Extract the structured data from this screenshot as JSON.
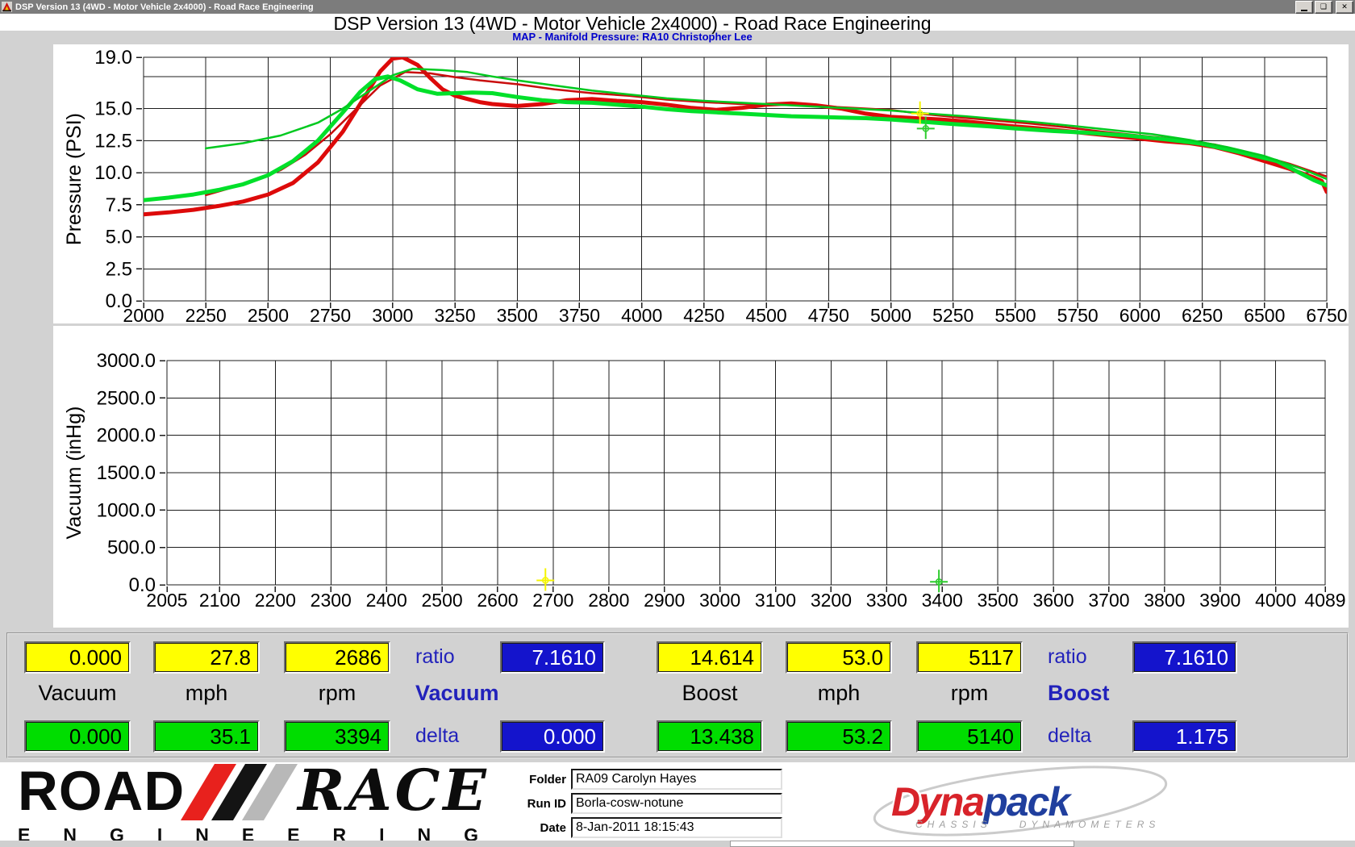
{
  "window": {
    "title": "DSP Version 13 (4WD - Motor Vehicle 2x4000) - Road Race Engineering",
    "icons": {
      "minimize": "_",
      "restore": "❏",
      "close": "✕"
    }
  },
  "header": {
    "title": "DSP Version 13 (4WD - Motor Vehicle 2x4000) - Road Race Engineering",
    "subtitle": "MAP - Manifold Pressure: RA10 Christopher Lee"
  },
  "chart_data": [
    {
      "type": "line",
      "name": "manifold-pressure-vs-rpm",
      "ylabel": "Pressure (PSI)",
      "xlim": [
        2000,
        6750
      ],
      "ylim": [
        0,
        19
      ],
      "xticks": [
        2000,
        2250,
        2500,
        2750,
        3000,
        3250,
        3500,
        3750,
        4000,
        4250,
        4500,
        4750,
        5000,
        5250,
        5500,
        5750,
        6000,
        6250,
        6500,
        6750
      ],
      "yticks_labeled": [
        0,
        2.5,
        5,
        7.5,
        10,
        12.5,
        15,
        19
      ],
      "ygrid": [
        2.5,
        5,
        7.5,
        10,
        12.5,
        15,
        17.5
      ],
      "grid": true,
      "series": [
        {
          "name": "boost-run1-thick-red",
          "color": "#dd0a0a",
          "width": 5,
          "points": [
            [
              2000,
              6.75
            ],
            [
              2100,
              6.9
            ],
            [
              2200,
              7.1
            ],
            [
              2300,
              7.4
            ],
            [
              2400,
              7.75
            ],
            [
              2500,
              8.3
            ],
            [
              2600,
              9.2
            ],
            [
              2700,
              10.8
            ],
            [
              2800,
              13.2
            ],
            [
              2900,
              16.3
            ],
            [
              2950,
              17.9
            ],
            [
              3000,
              18.9
            ],
            [
              3040,
              19.0
            ],
            [
              3100,
              18.4
            ],
            [
              3150,
              17.4
            ],
            [
              3200,
              16.5
            ],
            [
              3250,
              16.0
            ],
            [
              3300,
              15.75
            ],
            [
              3350,
              15.5
            ],
            [
              3400,
              15.35
            ],
            [
              3500,
              15.2
            ],
            [
              3600,
              15.35
            ],
            [
              3700,
              15.65
            ],
            [
              3800,
              15.75
            ],
            [
              3900,
              15.6
            ],
            [
              4000,
              15.5
            ],
            [
              4100,
              15.3
            ],
            [
              4200,
              15.05
            ],
            [
              4300,
              14.9
            ],
            [
              4400,
              15.05
            ],
            [
              4500,
              15.3
            ],
            [
              4600,
              15.4
            ],
            [
              4700,
              15.25
            ],
            [
              4800,
              15.0
            ],
            [
              4900,
              14.6
            ],
            [
              5000,
              14.35
            ],
            [
              5100,
              14.25
            ],
            [
              5200,
              14.15
            ],
            [
              5300,
              14.0
            ],
            [
              5400,
              13.8
            ],
            [
              5500,
              13.6
            ],
            [
              5600,
              13.45
            ],
            [
              5700,
              13.25
            ],
            [
              5800,
              13.05
            ],
            [
              5900,
              12.85
            ],
            [
              6000,
              12.65
            ],
            [
              6100,
              12.45
            ],
            [
              6200,
              12.3
            ],
            [
              6300,
              12.0
            ],
            [
              6400,
              11.5
            ],
            [
              6500,
              10.9
            ],
            [
              6600,
              10.3
            ],
            [
              6700,
              9.6
            ],
            [
              6730,
              9.35
            ],
            [
              6750,
              8.5
            ]
          ]
        },
        {
          "name": "boost-run2-thin-red",
          "color": "#c90d0d",
          "width": 2.5,
          "points": [
            [
              2250,
              8.25
            ],
            [
              2350,
              8.8
            ],
            [
              2450,
              9.4
            ],
            [
              2550,
              10.2
            ],
            [
              2650,
              11.4
            ],
            [
              2750,
              13.0
            ],
            [
              2850,
              14.9
            ],
            [
              2950,
              16.8
            ],
            [
              3050,
              17.85
            ],
            [
              3150,
              17.75
            ],
            [
              3250,
              17.45
            ],
            [
              3350,
              17.2
            ],
            [
              3500,
              16.9
            ],
            [
              3650,
              16.5
            ],
            [
              3800,
              16.2
            ],
            [
              3950,
              16.0
            ],
            [
              4100,
              15.7
            ],
            [
              4250,
              15.5
            ],
            [
              4400,
              15.35
            ],
            [
              4550,
              15.3
            ],
            [
              4700,
              15.2
            ],
            [
              4850,
              15.05
            ],
            [
              5000,
              14.9
            ],
            [
              5117,
              14.6
            ],
            [
              5250,
              14.35
            ],
            [
              5400,
              14.1
            ],
            [
              5550,
              13.85
            ],
            [
              5700,
              13.55
            ],
            [
              5850,
              13.2
            ],
            [
              6000,
              12.9
            ],
            [
              6150,
              12.6
            ],
            [
              6300,
              12.2
            ],
            [
              6450,
              11.5
            ],
            [
              6600,
              10.7
            ],
            [
              6750,
              9.7
            ]
          ]
        },
        {
          "name": "boost-run3-thick-green",
          "color": "#00e02a",
          "width": 5,
          "points": [
            [
              2000,
              7.85
            ],
            [
              2100,
              8.05
            ],
            [
              2200,
              8.3
            ],
            [
              2300,
              8.65
            ],
            [
              2400,
              9.1
            ],
            [
              2500,
              9.8
            ],
            [
              2600,
              10.9
            ],
            [
              2700,
              12.5
            ],
            [
              2800,
              14.7
            ],
            [
              2870,
              16.3
            ],
            [
              2930,
              17.3
            ],
            [
              2980,
              17.5
            ],
            [
              3030,
              17.2
            ],
            [
              3100,
              16.5
            ],
            [
              3180,
              16.15
            ],
            [
              3250,
              16.2
            ],
            [
              3320,
              16.25
            ],
            [
              3400,
              16.2
            ],
            [
              3500,
              15.9
            ],
            [
              3600,
              15.65
            ],
            [
              3700,
              15.5
            ],
            [
              3800,
              15.45
            ],
            [
              3900,
              15.3
            ],
            [
              4000,
              15.15
            ],
            [
              4100,
              14.95
            ],
            [
              4200,
              14.8
            ],
            [
              4300,
              14.7
            ],
            [
              4400,
              14.6
            ],
            [
              4500,
              14.5
            ],
            [
              4600,
              14.4
            ],
            [
              4700,
              14.35
            ],
            [
              4800,
              14.3
            ],
            [
              4900,
              14.25
            ],
            [
              5000,
              14.15
            ],
            [
              5140,
              13.95
            ],
            [
              5250,
              13.8
            ],
            [
              5400,
              13.6
            ],
            [
              5500,
              13.45
            ],
            [
              5650,
              13.25
            ],
            [
              5800,
              13.1
            ],
            [
              5950,
              12.9
            ],
            [
              6100,
              12.6
            ],
            [
              6250,
              12.25
            ],
            [
              6400,
              11.6
            ],
            [
              6550,
              10.9
            ],
            [
              6700,
              9.4
            ],
            [
              6750,
              9.0
            ]
          ]
        },
        {
          "name": "boost-run4-thin-green",
          "color": "#00c91f",
          "width": 2.5,
          "points": [
            [
              2250,
              11.9
            ],
            [
              2400,
              12.3
            ],
            [
              2550,
              12.9
            ],
            [
              2700,
              13.9
            ],
            [
              2800,
              15.0
            ],
            [
              2900,
              16.3
            ],
            [
              3000,
              17.6
            ],
            [
              3080,
              18.1
            ],
            [
              3200,
              18.0
            ],
            [
              3300,
              17.85
            ],
            [
              3400,
              17.5
            ],
            [
              3500,
              17.2
            ],
            [
              3650,
              16.8
            ],
            [
              3800,
              16.4
            ],
            [
              3950,
              16.1
            ],
            [
              4100,
              15.8
            ],
            [
              4250,
              15.6
            ],
            [
              4400,
              15.45
            ],
            [
              4550,
              15.3
            ],
            [
              4700,
              15.15
            ],
            [
              4850,
              15.0
            ],
            [
              5000,
              14.85
            ],
            [
              5150,
              14.6
            ],
            [
              5300,
              14.4
            ],
            [
              5450,
              14.15
            ],
            [
              5600,
              13.9
            ],
            [
              5750,
              13.6
            ],
            [
              5900,
              13.3
            ],
            [
              6050,
              13.0
            ],
            [
              6200,
              12.55
            ],
            [
              6350,
              12.0
            ],
            [
              6500,
              11.3
            ],
            [
              6650,
              10.3
            ],
            [
              6750,
              9.5
            ]
          ]
        }
      ],
      "markers": [
        {
          "x": 5117,
          "y": 14.614,
          "color": "#f5f500"
        },
        {
          "x": 5140,
          "y": 13.438,
          "color": "#2ecc2e"
        }
      ]
    },
    {
      "type": "line",
      "name": "vacuum-vs-rpm",
      "ylabel": "Vacuum (inHg)",
      "xlim": [
        2005,
        4089
      ],
      "ylim": [
        0,
        3000
      ],
      "xticks": [
        2005,
        2100,
        2200,
        2300,
        2400,
        2500,
        2600,
        2700,
        2800,
        2900,
        3000,
        3100,
        3200,
        3300,
        3400,
        3500,
        3600,
        3700,
        3800,
        3900,
        4000,
        4089
      ],
      "yticks_labeled": [
        0,
        500,
        1000,
        1500,
        2000,
        2500,
        3000
      ],
      "ygrid": [
        500,
        1000,
        1500,
        2000,
        2500
      ],
      "grid": true,
      "series": [],
      "markers": [
        {
          "x": 2686,
          "y": 60,
          "color": "#f5f500"
        },
        {
          "x": 3394,
          "y": 40,
          "color": "#2ecc2e"
        }
      ]
    }
  ],
  "panels": {
    "left": {
      "row1": [
        "0.000",
        "27.8",
        "2686"
      ],
      "ratio_label": "ratio",
      "ratio_value": "7.1610",
      "col_labels": [
        "Vacuum",
        "mph",
        "rpm"
      ],
      "group_label": "Vacuum",
      "row2": [
        "0.000",
        "35.1",
        "3394"
      ],
      "delta_label": "delta",
      "delta_value": "0.000"
    },
    "right": {
      "row1": [
        "14.614",
        "53.0",
        "5117"
      ],
      "ratio_label": "ratio",
      "ratio_value": "7.1610",
      "col_labels": [
        "Boost",
        "mph",
        "rpm"
      ],
      "group_label": "Boost",
      "row2": [
        "13.438",
        "53.2",
        "5140"
      ],
      "delta_label": "delta",
      "delta_value": "1.175"
    }
  },
  "footer": {
    "logo": {
      "road": "ROAD",
      "race": "RACE",
      "engineering": "ENGINEERING"
    },
    "fields": [
      {
        "label": "Folder",
        "value": "RA09 Carolyn Hayes"
      },
      {
        "label": "Run ID",
        "value": "Borla-cosw-notune"
      },
      {
        "label": "Date",
        "value": "8-Jan-2011 18:15:43"
      }
    ],
    "dynapack": {
      "dyna": "Dyna",
      "pack": "pack",
      "sub_left": "CHASSIS",
      "sub_right": "DYNAMOMETERS"
    }
  }
}
